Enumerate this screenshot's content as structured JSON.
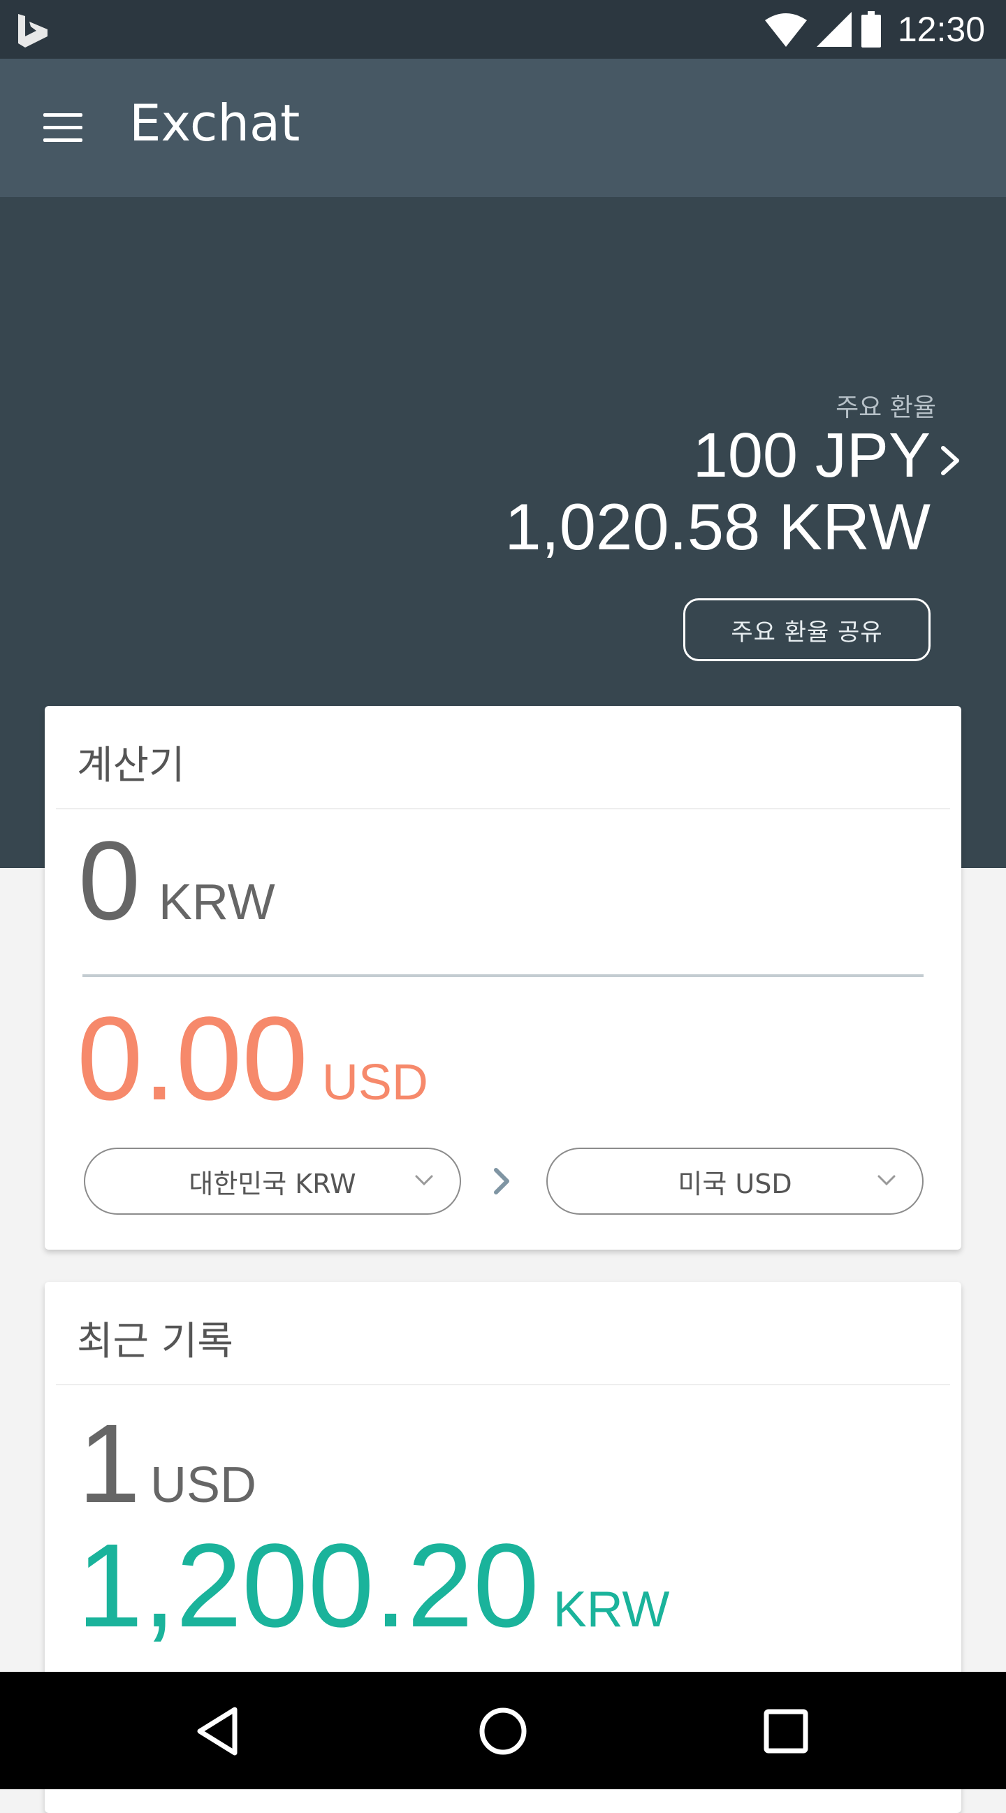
{
  "status_bar": {
    "time": "12:30",
    "icons": [
      "bing-logo-icon",
      "wifi-icon",
      "signal-icon",
      "battery-icon"
    ]
  },
  "app_bar": {
    "title": "Exchat",
    "menu_icon": "hamburger-menu-icon"
  },
  "hero": {
    "label": "주요 환율",
    "from_amount": "100 JPY",
    "to_amount": "1,020.58 KRW",
    "share_button": "주요 환율 공유"
  },
  "calculator": {
    "title": "계산기",
    "input_value": "0",
    "input_unit": "KRW",
    "output_value": "0.00",
    "output_unit": "USD",
    "from_currency": "대한민국 KRW",
    "to_currency": "미국 USD"
  },
  "recent": {
    "title": "최근 기록",
    "items": [
      {
        "from_value": "1",
        "from_unit": "USD",
        "to_value": "1,200.20",
        "to_unit": "KRW"
      }
    ]
  },
  "colors": {
    "status_bar": "#2c3740",
    "app_bar": "#475864",
    "hero": "#37464f",
    "output_orange": "#f6896b",
    "output_teal": "#1ab39b"
  }
}
